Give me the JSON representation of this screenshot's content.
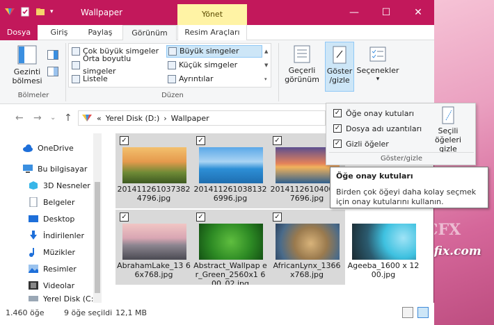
{
  "window": {
    "title": "Wallpaper",
    "context_tab": "Yönet",
    "controls": {
      "minimize": "—",
      "maximize": "☐",
      "close": "✕"
    }
  },
  "tabs": [
    {
      "label": "Dosya"
    },
    {
      "label": "Giriş"
    },
    {
      "label": "Paylaş"
    },
    {
      "label": "Görünüm"
    },
    {
      "label": "Resim Araçları"
    }
  ],
  "ribbon": {
    "panes": {
      "nav_line1": "Gezinti",
      "nav_line2": "bölmesi",
      "group": "Bölmeler"
    },
    "layout": {
      "group": "Düzen",
      "items": [
        "Çok büyük simgeler",
        "Büyük simgeler",
        "Orta boyutlu simgeler",
        "Küçük simgeler",
        "Listele",
        "Ayrıntılar"
      ]
    },
    "current_view": {
      "line1": "Geçerli",
      "line2": "görünüm"
    },
    "show_hide": {
      "line1": "Göster",
      "line2": "/gizle"
    },
    "options": "Seçenekler"
  },
  "address": {
    "prefix": "«",
    "path": [
      "Yerel Disk (D:)",
      "Wallpaper"
    ],
    "separator": "›"
  },
  "sidebar": {
    "items": [
      "OneDrive",
      "Bu bilgisayar",
      "3D Nesneler",
      "Belgeler",
      "Desktop",
      "İndirilenler",
      "Müzikler",
      "Resimler",
      "Videolar",
      "Yerel Disk (C:)"
    ]
  },
  "files": [
    {
      "name": "201411261037382 4796.jpg",
      "checked": true
    },
    {
      "name": "201411261038132 6996.jpg",
      "checked": true
    },
    {
      "name": "201411261040067 7696.jpg",
      "checked": true
    },
    {
      "name": "AbrahamLake_13 66x768.jpg",
      "checked": true
    },
    {
      "name": "Abstract_Wallpap er_Green_2560x1 600_02.jpg",
      "checked": true
    },
    {
      "name": "AfricanLynx_1366 x768.jpg",
      "checked": true
    },
    {
      "name": "Ageeba_1600 x 1200.jpg",
      "checked": false
    }
  ],
  "status": {
    "count": "1.460 öğe",
    "selected": "9 öğe seçildi",
    "size": "12,1 MB"
  },
  "dropdown": {
    "items": [
      "Öğe onay kutuları",
      "Dosya adı uzantıları",
      "Gizli öğeler"
    ],
    "hide_selected_line1": "Seçili öğeleri",
    "hide_selected_line2": "gizle",
    "group": "Göster/gizle"
  },
  "tooltip": {
    "title": "Öğe onay kutuları",
    "body": "Birden çok öğeyi daha kolay seçmek için onay kutularını kullanın."
  },
  "watermark": {
    "logo": "CFX",
    "text": "Ceofix.com"
  },
  "colors": {
    "accent": "#c2185b",
    "selection": "#cde6f7",
    "context_tab": "#fff3a5"
  }
}
